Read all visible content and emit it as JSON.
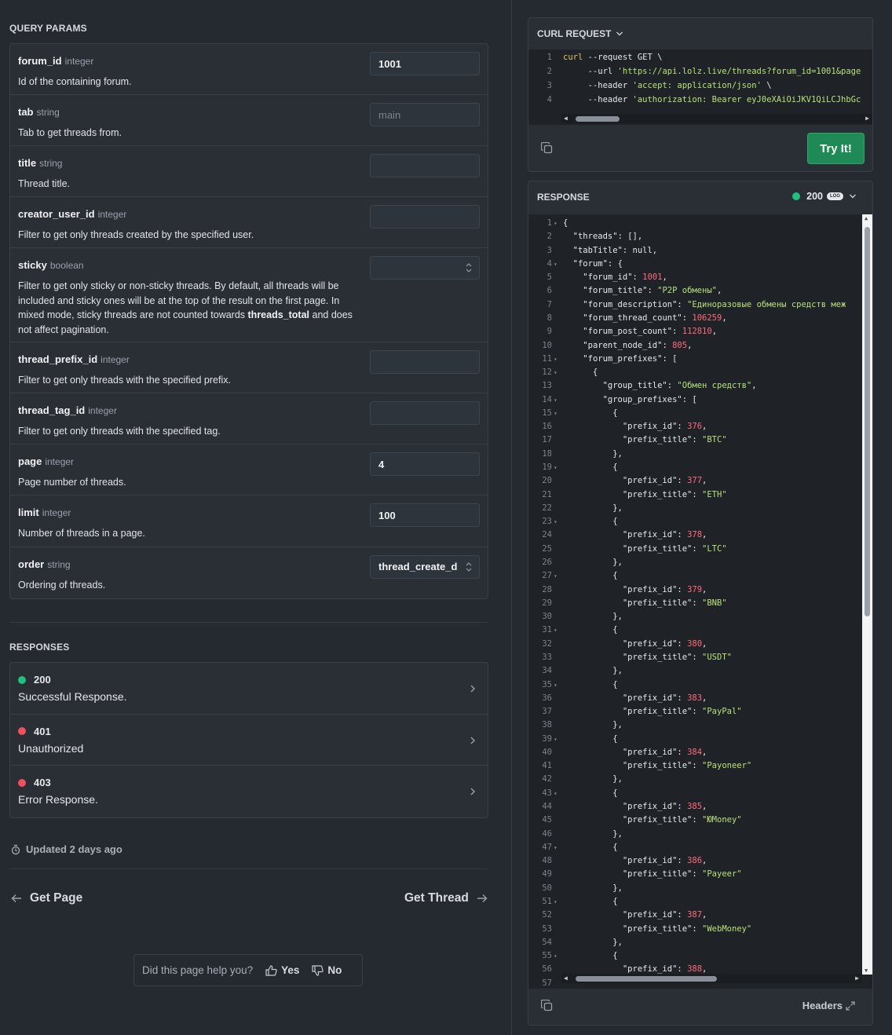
{
  "query_params": {
    "title": "QUERY PARAMS",
    "items": [
      {
        "name": "forum_id",
        "type": "integer",
        "desc": "Id of the containing forum.",
        "value": "1001",
        "placeholder": ""
      },
      {
        "name": "tab",
        "type": "string",
        "desc": "Tab to get threads from.",
        "value": "",
        "placeholder": "main"
      },
      {
        "name": "title",
        "type": "string",
        "desc": "Thread title.",
        "value": "",
        "placeholder": ""
      },
      {
        "name": "creator_user_id",
        "type": "integer",
        "desc": "Filter to get only threads created by the specified user.",
        "value": "",
        "placeholder": ""
      },
      {
        "name": "sticky",
        "type": "boolean",
        "desc_pre": "Filter to get only sticky or non-sticky threads. By default, all threads will be included and sticky ones will be at the top of the result on the first page. In mixed mode, sticky threads are not counted towards ",
        "desc_bold": "threads_total",
        "desc_post": " and does not affect pagination.",
        "value": ""
      },
      {
        "name": "thread_prefix_id",
        "type": "integer",
        "desc": "Filter to get only threads with the specified prefix.",
        "value": "",
        "placeholder": ""
      },
      {
        "name": "thread_tag_id",
        "type": "integer",
        "desc": "Filter to get only threads with the specified tag.",
        "value": "",
        "placeholder": ""
      },
      {
        "name": "page",
        "type": "integer",
        "desc": "Page number of threads.",
        "value": "4",
        "placeholder": ""
      },
      {
        "name": "limit",
        "type": "integer",
        "desc": "Number of threads in a page.",
        "value": "100",
        "placeholder": ""
      },
      {
        "name": "order",
        "type": "string",
        "desc": "Ordering of threads.",
        "value": "thread_create_d"
      }
    ]
  },
  "responses": {
    "title": "RESPONSES",
    "items": [
      {
        "code": "200",
        "desc": "Successful Response.",
        "color": "#22c07f"
      },
      {
        "code": "401",
        "desc": "Unauthorized",
        "color": "#f0505e"
      },
      {
        "code": "403",
        "desc": "Error Response.",
        "color": "#f0505e"
      }
    ]
  },
  "updated": "Updated 2 days ago",
  "nav": {
    "prev": "Get Page",
    "next": "Get Thread"
  },
  "feedback": {
    "question": "Did this page help you?",
    "yes": "Yes",
    "no": "No"
  },
  "curl": {
    "title": "CURL REQUEST",
    "lines": [
      "curl --request GET \\",
      "     --url 'https://api.lolz.live/threads?forum_id=1001&page",
      "     --header 'accept: application/json' \\",
      "     --header 'authorization: Bearer eyJ0eXAiOiJKV1QiLCJhbGc"
    ],
    "try_label": "Try It!"
  },
  "response_panel": {
    "title": "RESPONSE",
    "status": "200",
    "log": "LOG",
    "headers_label": "Headers",
    "lines": [
      "{",
      "  \"threads\": [],",
      "  \"tabTitle\": null,",
      "  \"forum\": {",
      "    \"forum_id\": 1001,",
      "    \"forum_title\": \"P2P обмены\",",
      "    \"forum_description\": \"Единоразовые обмены средств меж",
      "    \"forum_thread_count\": 106259,",
      "    \"forum_post_count\": 112810,",
      "    \"parent_node_id\": 805,",
      "    \"forum_prefixes\": [",
      "      {",
      "        \"group_title\": \"Обмен средств\",",
      "        \"group_prefixes\": [",
      "          {",
      "            \"prefix_id\": 376,",
      "            \"prefix_title\": \"BTC\"",
      "          },",
      "          {",
      "            \"prefix_id\": 377,",
      "            \"prefix_title\": \"ETH\"",
      "          },",
      "          {",
      "            \"prefix_id\": 378,",
      "            \"prefix_title\": \"LTC\"",
      "          },",
      "          {",
      "            \"prefix_id\": 379,",
      "            \"prefix_title\": \"BNB\"",
      "          },",
      "          {",
      "            \"prefix_id\": 380,",
      "            \"prefix_title\": \"USDT\"",
      "          },",
      "          {",
      "            \"prefix_id\": 383,",
      "            \"prefix_title\": \"PayPal\"",
      "          },",
      "          {",
      "            \"prefix_id\": 384,",
      "            \"prefix_title\": \"Payoneer\"",
      "          },",
      "          {",
      "            \"prefix_id\": 385,",
      "            \"prefix_title\": \"ЮMoney\"",
      "          },",
      "          {",
      "            \"prefix_id\": 386,",
      "            \"prefix_title\": \"Payeer\"",
      "          },",
      "          {",
      "            \"prefix_id\": 387,",
      "            \"prefix_title\": \"WebMoney\"",
      "          },",
      "          {",
      "            \"prefix_id\": 388,",
      ""
    ],
    "fold_lines": [
      1,
      4,
      11,
      12,
      14,
      15,
      19,
      23,
      27,
      31,
      35,
      39,
      43,
      47,
      51,
      55
    ]
  }
}
